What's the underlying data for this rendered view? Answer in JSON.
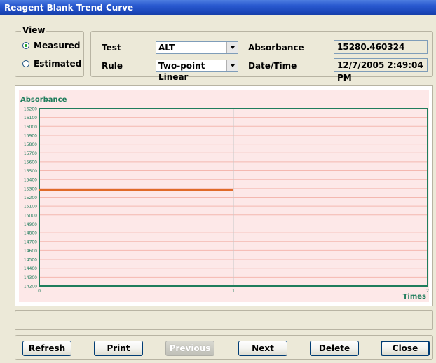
{
  "window": {
    "title": "Reagent Blank Trend Curve"
  },
  "view": {
    "legend": "View",
    "options": [
      {
        "label": "Measured",
        "selected": true
      },
      {
        "label": "Estimated",
        "selected": false
      }
    ]
  },
  "fields": {
    "test_label": "Test",
    "test_value": "ALT",
    "rule_label": "Rule",
    "rule_value": "Two-point Linear",
    "absorbance_label": "Absorbance",
    "absorbance_value": "15280.460324",
    "datetime_label": "Date/Time",
    "datetime_value": "12/7/2005 2:49:04 PM"
  },
  "chart_data": {
    "type": "line",
    "ylabel": "Absorbance",
    "xlabel": "Times",
    "ylim": [
      14200,
      16200
    ],
    "xlim": [
      0,
      2
    ],
    "yticks": [
      16200,
      16100,
      16000,
      15900,
      15800,
      15700,
      15600,
      15500,
      15400,
      15300,
      15200,
      15100,
      15000,
      14900,
      14800,
      14700,
      14600,
      14500,
      14400,
      14300,
      14200
    ],
    "xticks": [
      "0",
      "1",
      "2"
    ],
    "grid": true,
    "series": [
      {
        "x": [
          0,
          1
        ],
        "y": [
          15280.46,
          15280.46
        ],
        "color": "#e06a28"
      }
    ],
    "colors": {
      "axis": "#1f7d5c",
      "grid": "#f4b8b0",
      "background": "#fde8e8",
      "label": "#1f7d5c"
    }
  },
  "status": {
    "text": ""
  },
  "buttons": {
    "refresh": "Refresh",
    "print": "Print",
    "previous": "Previous",
    "next": "Next",
    "delete": "Delete",
    "close": "Close"
  }
}
